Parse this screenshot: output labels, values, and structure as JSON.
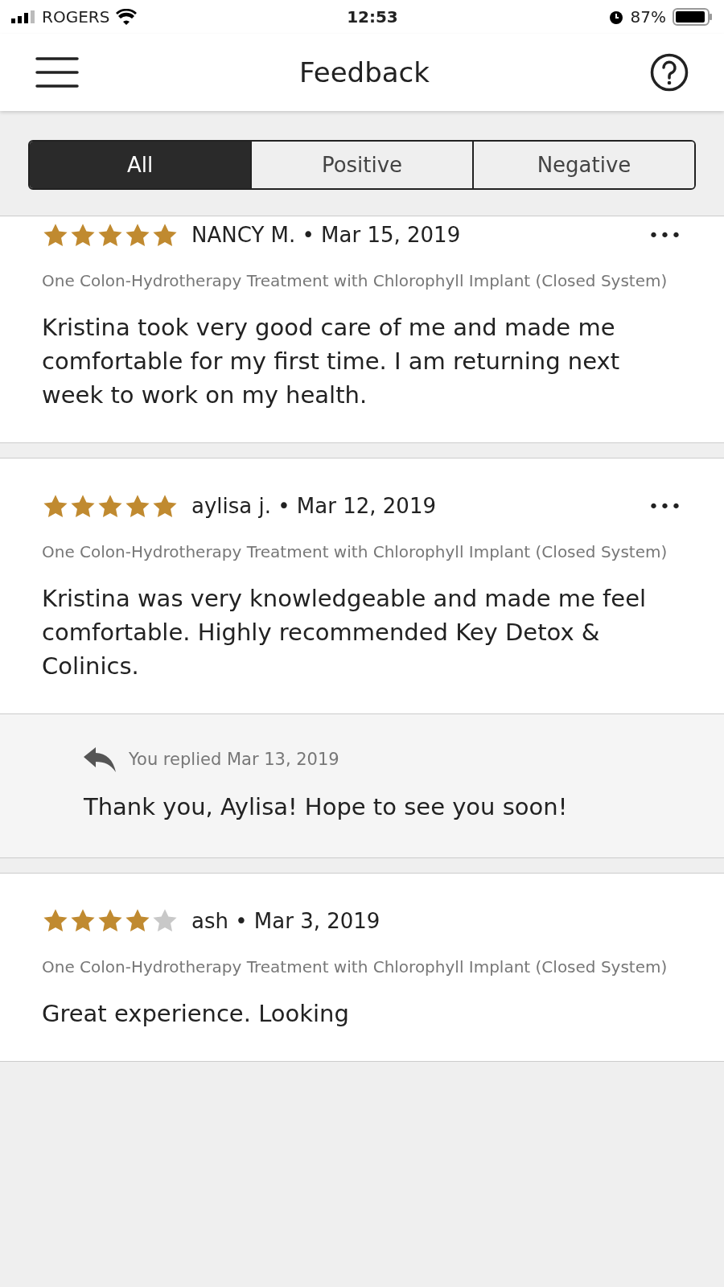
{
  "status_bar": {
    "carrier": "ROGERS",
    "time": "12:53",
    "battery": "87%"
  },
  "header": {
    "title": "Feedback"
  },
  "tabs": [
    {
      "label": "All",
      "selected": true
    },
    {
      "label": "Positive",
      "selected": false
    },
    {
      "label": "Negative",
      "selected": false
    }
  ],
  "reviews": [
    {
      "stars": 5,
      "author": "NANCY M. • Mar 15, 2019",
      "more": "•••",
      "service": "One Colon-Hydrotherapy Treatment with Chlorophyll Implant (Closed System)",
      "text": "Kristina took very good care of me and made me comfortable for my first time. I am returning next week to work on my health."
    },
    {
      "stars": 5,
      "author": "aylisa j. • Mar 12, 2019",
      "more": "•••",
      "service": "One Colon-Hydrotherapy Treatment with Chlorophyll Implant (Closed System)",
      "text": "Kristina was very knowledgeable and made me feel comfortable. Highly recommended Key Detox & Colinics.",
      "reply": {
        "meta": "You replied Mar 13, 2019",
        "text": "Thank you, Aylisa! Hope to see you soon!"
      }
    },
    {
      "stars": 4,
      "author": "ash • Mar 3, 2019",
      "service": "One Colon-Hydrotherapy Treatment with Chlorophyll Implant (Closed System)",
      "text": "Great experience. Looking"
    }
  ]
}
